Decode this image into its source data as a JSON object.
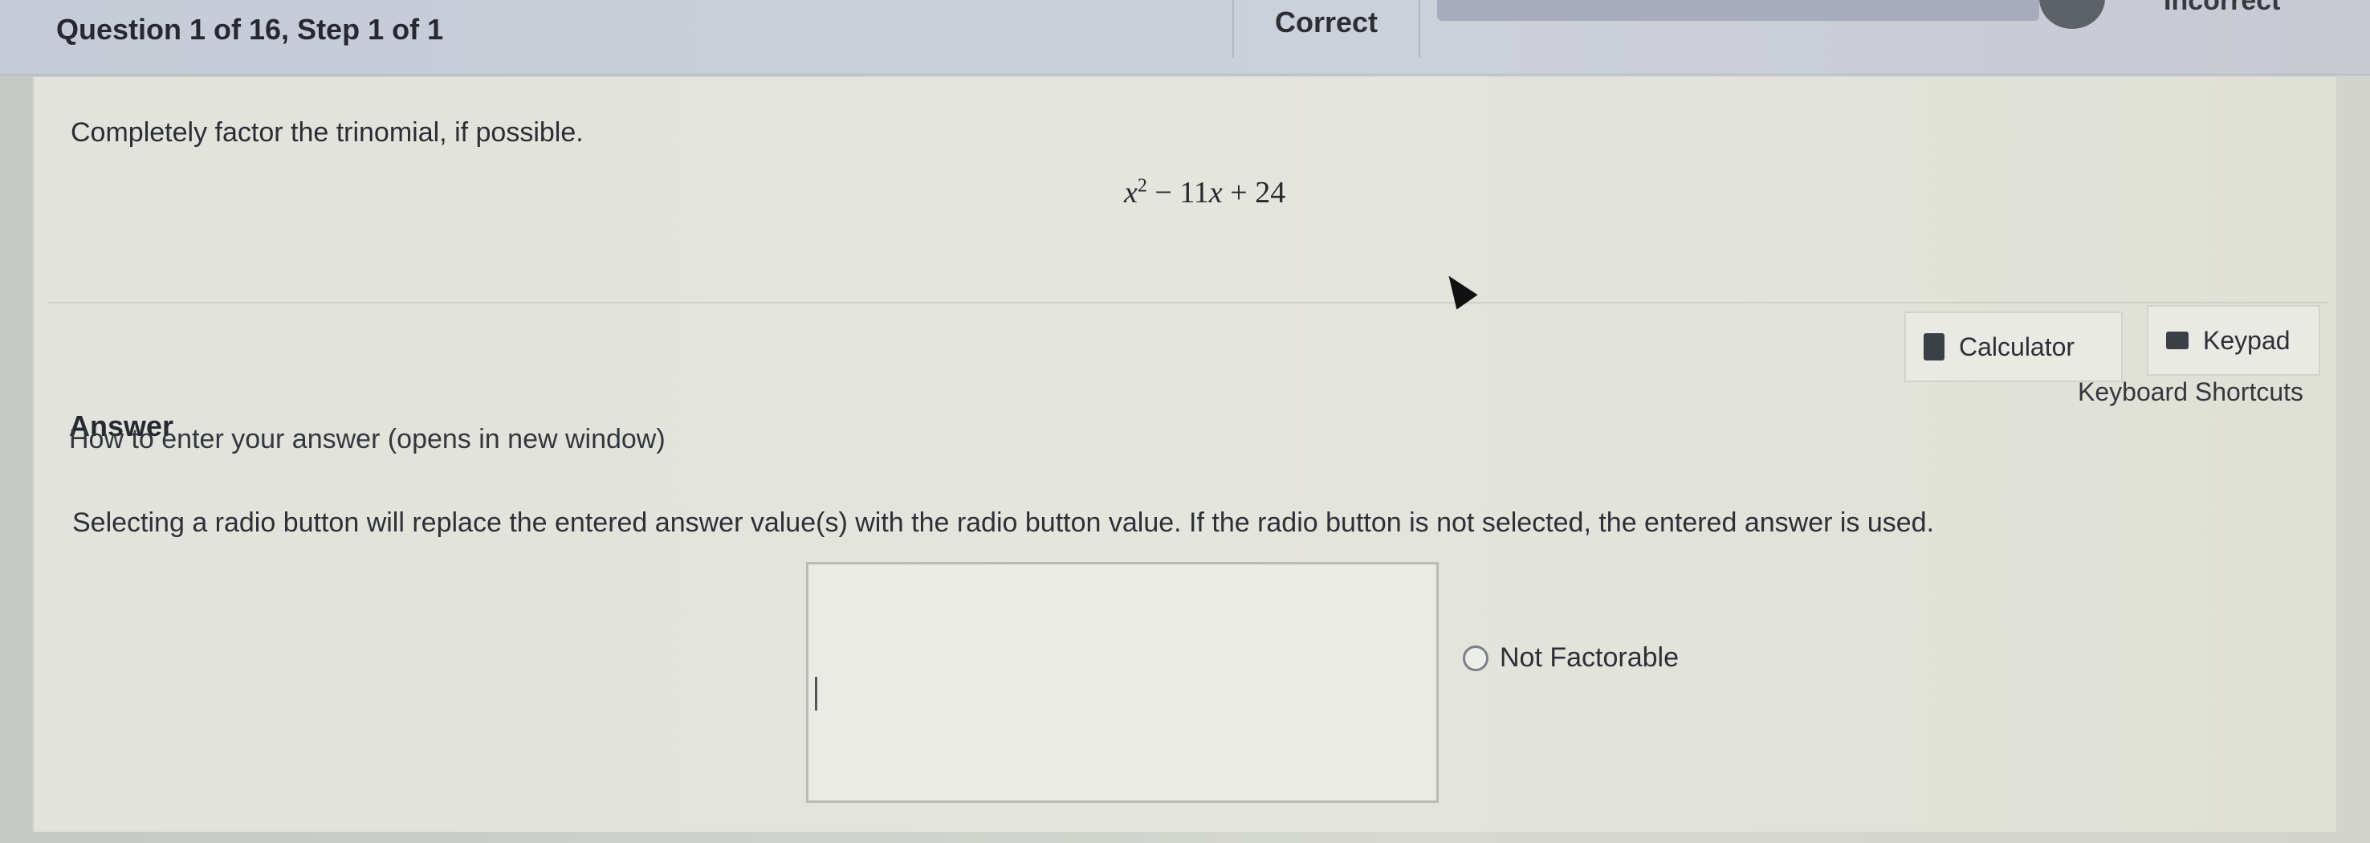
{
  "header": {
    "question_title": "Question 1 of 16,  Step 1 of 1",
    "status_correct": "Correct",
    "status_incorrect": "Incorrect"
  },
  "question": {
    "prompt": "Completely factor the trinomial, if possible.",
    "expression": {
      "var": "x",
      "exp": "2",
      "rest": " − 11",
      "var2": "x",
      "tail": " + 24"
    }
  },
  "tools": {
    "calculator_label": "Calculator",
    "keypad_label": "Keypad",
    "shortcuts_label": "Keyboard Shortcuts"
  },
  "answer": {
    "heading": "Answer",
    "howto_link": "How to enter your answer (opens in new window)",
    "instruction": "Selecting a radio button will replace the entered answer value(s) with the radio button value. If the radio button is not selected, the entered answer is used.",
    "input_value": "",
    "radio_label": "Not Factorable",
    "radio_selected": false
  },
  "colors": {
    "accent": "#2b2e33",
    "tab_inactive": "#a7abbb"
  }
}
